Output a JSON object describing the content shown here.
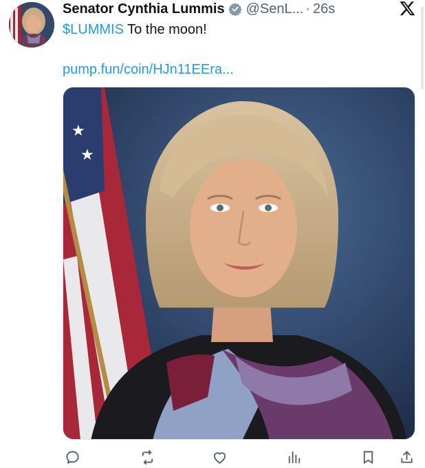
{
  "tweet": {
    "author_name": "Senator Cynthia Lummis",
    "handle": "@SenL...",
    "separator": "·",
    "time": "26s",
    "cashtag": "$LUMMIS",
    "text": " To the moon!",
    "link": "pump.fun/coin/HJn11EEra..."
  },
  "icons": {
    "verified": "verified-badge-icon",
    "logo": "x-logo-icon",
    "actions": [
      "reply-icon",
      "retweet-icon",
      "like-icon",
      "views-icon",
      "bookmark-icon",
      "share-icon"
    ]
  },
  "colors": {
    "accent": "#1d9bf0",
    "secondary_text": "#536471",
    "primary_text": "#0f1419",
    "verified_badge": "#829aab"
  }
}
